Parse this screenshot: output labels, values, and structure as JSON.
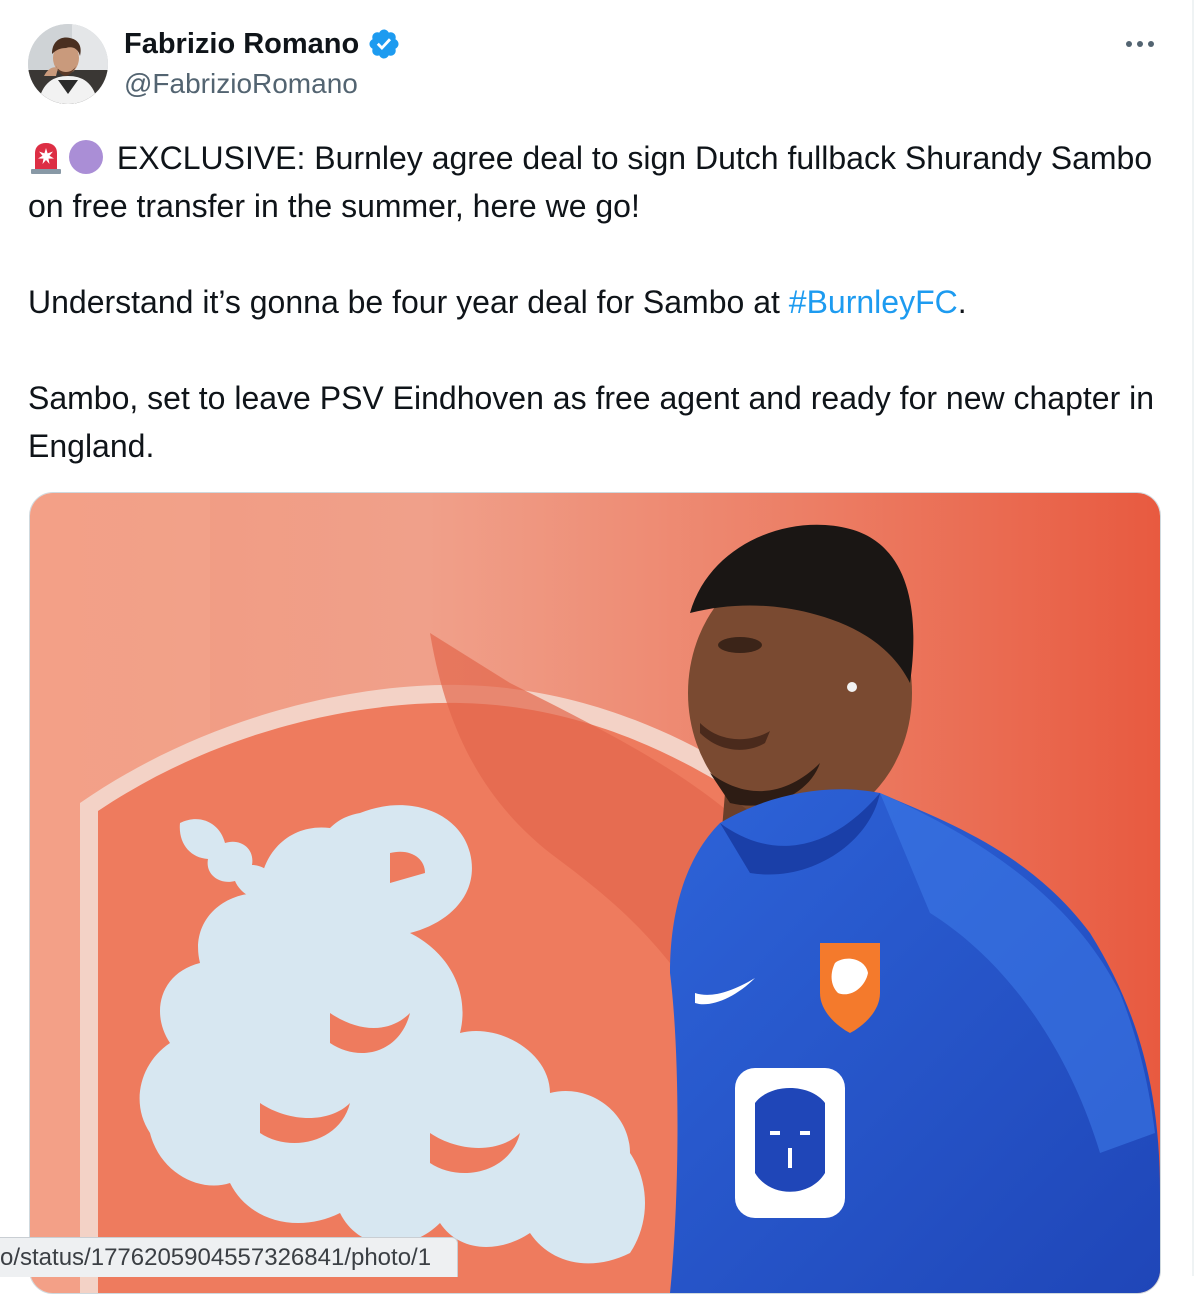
{
  "author": {
    "name": "Fabrizio Romano",
    "handle": "@FabrizioRomano",
    "verified": true
  },
  "icons": {
    "verified": "verified-badge-icon",
    "more": "more-dots-icon",
    "emoji_1": "rotating-light-emoji",
    "emoji_2": "purple-circle-emoji"
  },
  "tweet": {
    "line1_text": " EXCLUSIVE: Burnley agree deal to sign Dutch fullback Shurandy Sambo on free transfer in the summer, here we go!",
    "line2_prefix": "Understand it’s gonna be four year deal for Sambo at ",
    "hashtag": "#BurnleyFC",
    "line2_suffix": ".",
    "line3_text": "Sambo, set to leave PSV Eindhoven as free agent and ready for new chapter in England."
  },
  "media": {
    "alt": "photo"
  },
  "status_url": "o/status/1776205904557326841/photo/1",
  "colors": {
    "link": "#1d9bf0",
    "verified": "#1d9bf0",
    "handle": "#536471"
  }
}
